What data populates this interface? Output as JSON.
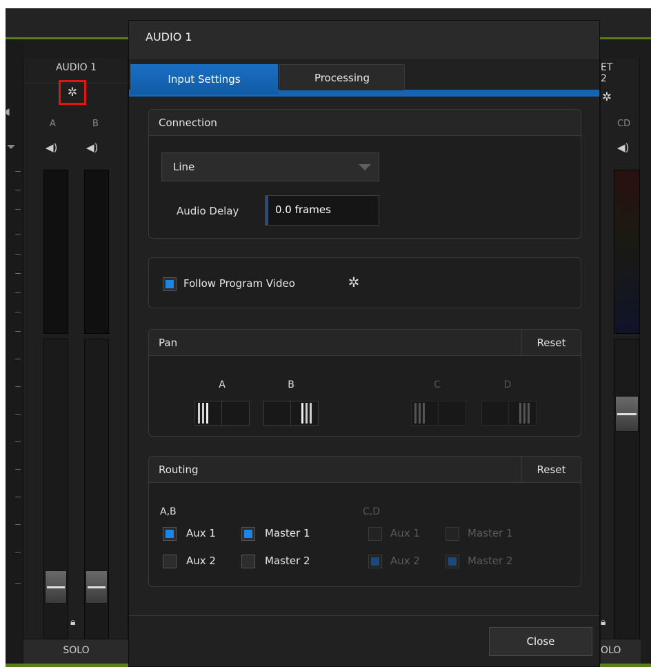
{
  "background": {
    "left_strip": {
      "title": "AUDIO 1",
      "channels": [
        "A",
        "B"
      ],
      "solo": "SOLO"
    },
    "right_strip": {
      "title": "ET 2",
      "channel": "CD",
      "solo": "OLO"
    }
  },
  "dialog": {
    "title": "AUDIO 1",
    "tabs": [
      {
        "label": "Input Settings",
        "active": true
      },
      {
        "label": "Processing",
        "active": false
      }
    ],
    "connection": {
      "title": "Connection",
      "source": "Line",
      "delay_label": "Audio Delay",
      "delay_value": "0.0 frames"
    },
    "follow": {
      "label": "Follow Program Video",
      "checked": true
    },
    "pan": {
      "title": "Pan",
      "reset": "Reset",
      "channels": [
        {
          "label": "A",
          "enabled": true
        },
        {
          "label": "B",
          "enabled": true
        },
        {
          "label": "C",
          "enabled": false
        },
        {
          "label": "D",
          "enabled": false
        }
      ]
    },
    "routing": {
      "title": "Routing",
      "reset": "Reset",
      "groups": [
        {
          "label": "A,B",
          "enabled": true,
          "options": [
            {
              "label": "Aux 1",
              "checked": true
            },
            {
              "label": "Master 1",
              "checked": true
            },
            {
              "label": "Aux 2",
              "checked": false
            },
            {
              "label": "Master 2",
              "checked": false
            }
          ]
        },
        {
          "label": "C,D",
          "enabled": false,
          "options": [
            {
              "label": "Aux 1",
              "checked": false
            },
            {
              "label": "Master 1",
              "checked": false
            },
            {
              "label": "Aux 2",
              "checked": true
            },
            {
              "label": "Master 2",
              "checked": true
            }
          ]
        }
      ]
    },
    "close_label": "Close"
  },
  "colors": {
    "accent_blue": "#1c86e8",
    "tab_blue": "#1564b3",
    "highlight_red": "#e01616",
    "green_line": "#5a7f1a"
  },
  "icons": [
    "gear-icon",
    "speaker-icon",
    "lock-icon",
    "dropdown-arrow-icon"
  ]
}
